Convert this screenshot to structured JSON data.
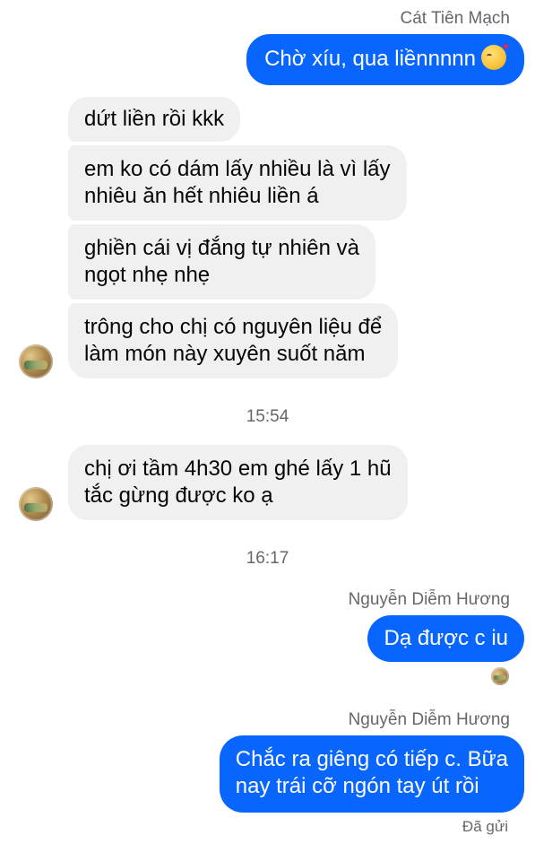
{
  "conversation": {
    "top_sender": "Cát Tiên Mạch",
    "top_message": "Chờ xíu, qua liềnnnnn",
    "top_message_emoji": "kissing-face-heart-icon",
    "incoming_group_1": [
      "dứt liền rồi kkk",
      "em ko có dám lấy nhiều là vì lấy\nnhiêu ăn hết nhiêu liền á",
      "ghiền cái vị đắng tự nhiên và\nngọt nhẹ nhẹ",
      "trông cho chị có nguyên liệu để\nlàm món này xuyên suốt năm"
    ],
    "time_1": "15:54",
    "incoming_2": "chị ơi tầm 4h30 em ghé lấy 1 hũ\ntắc gừng được ko ạ",
    "time_2": "16:17",
    "reply_sender_1": "Nguyễn Diễm Hương",
    "reply_1": "Dạ được c iu",
    "reply_sender_2": "Nguyễn Diễm Hương",
    "reply_2": "Chắc ra giêng có tiếp c. Bữa\nnay trái cỡ ngón tay út rồi",
    "status": "Đã gửi"
  },
  "colors": {
    "outgoing_bubble": "#0866ff",
    "incoming_bubble": "#f0f0f0",
    "meta_text": "#65676b"
  }
}
